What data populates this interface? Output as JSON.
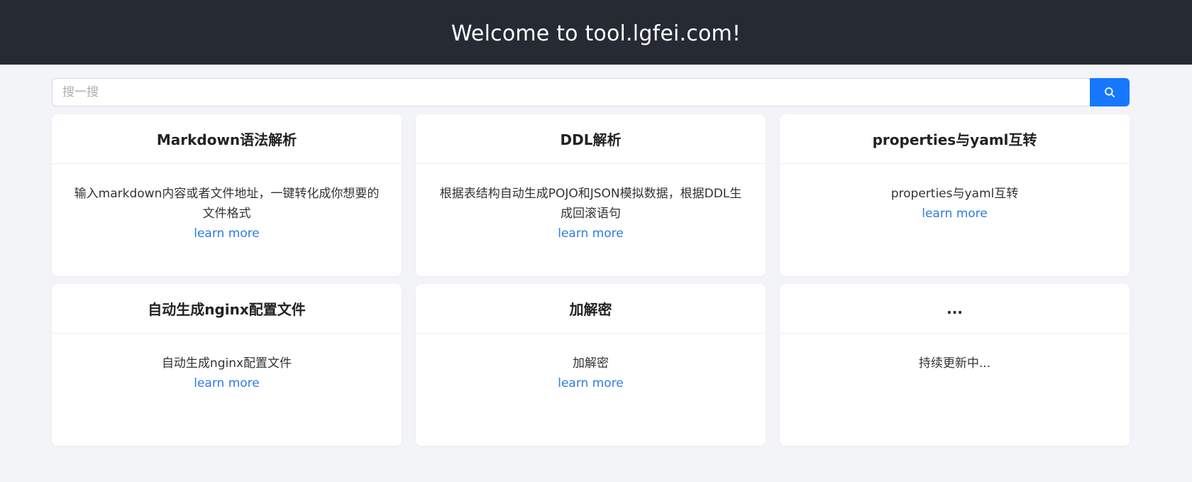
{
  "header": {
    "title": "Welcome to tool.lgfei.com!"
  },
  "search": {
    "placeholder": "搜一搜",
    "button_icon": "search-icon"
  },
  "colors": {
    "navbar": "#262a33",
    "accent": "#1677ff",
    "link": "#2f7ae6",
    "page_bg": "#f3f4f8"
  },
  "cards": [
    {
      "title": "Markdown语法解析",
      "desc": "输入markdown内容或者文件地址，一键转化成你想要的文件格式",
      "link": "learn more"
    },
    {
      "title": "DDL解析",
      "desc": "根据表结构自动生成POJO和JSON模拟数据，根据DDL生成回滚语句",
      "link": "learn more"
    },
    {
      "title": "properties与yaml互转",
      "desc": "properties与yaml互转",
      "link": "learn more"
    },
    {
      "title": "自动生成nginx配置文件",
      "desc": "自动生成nginx配置文件",
      "link": "learn more"
    },
    {
      "title": "加解密",
      "desc": "加解密",
      "link": "learn more"
    },
    {
      "title": "...",
      "desc": "持续更新中...",
      "link": ""
    }
  ]
}
